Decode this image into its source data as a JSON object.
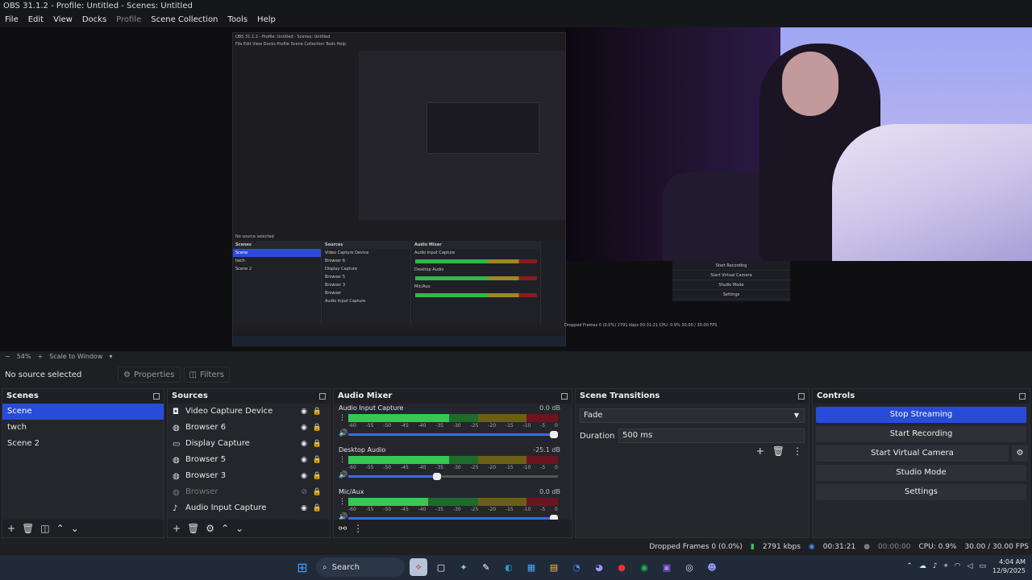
{
  "window": {
    "title": "OBS 31.1.2 - Profile: Untitled - Scenes: Untitled"
  },
  "menu": [
    "File",
    "Edit",
    "View",
    "Docks",
    "Profile",
    "Scene Collection",
    "Tools",
    "Help"
  ],
  "nested_preview": {
    "title": "OBS 31.1.2 - Profile: Untitled - Scenes: Untitled",
    "menu": "File  Edit  View  Docks  Profile  Scene Collection  Tools  Help",
    "source_label": "No source selected",
    "scenes": [
      "Scene",
      "twch",
      "Scene 2"
    ],
    "sources": [
      "Video Capture Device",
      "Browser 6",
      "Display Capture",
      "Browser 5",
      "Browser 3",
      "Browser",
      "Audio Input Capture"
    ],
    "mixer_channels": [
      "Audio Input Capture",
      "Desktop Audio",
      "Mic/Aux"
    ],
    "controls": [
      "Start Recording",
      "Start Virtual Camera",
      "Studio Mode",
      "Settings"
    ],
    "status": "Dropped Frames 0 (0.0%)  2791 kbps  00:31:21  CPU: 0.9%  30.00 / 30.00 FPS"
  },
  "zoom": {
    "level": "54%",
    "mode": "Scale to Window"
  },
  "source_bar": {
    "none": "No source selected",
    "properties": "Properties",
    "filters": "Filters"
  },
  "scenes": {
    "title": "Scenes",
    "items": [
      {
        "label": "Scene",
        "selected": true
      },
      {
        "label": "twch",
        "selected": false
      },
      {
        "label": "Scene 2",
        "selected": false
      }
    ]
  },
  "sources": {
    "title": "Sources",
    "items": [
      {
        "label": "Video Capture Device",
        "icon": "camera-icon",
        "visible": true
      },
      {
        "label": "Browser 6",
        "icon": "globe-icon",
        "visible": true
      },
      {
        "label": "Display Capture",
        "icon": "monitor-icon",
        "visible": true
      },
      {
        "label": "Browser 5",
        "icon": "globe-icon",
        "visible": true
      },
      {
        "label": "Browser 3",
        "icon": "globe-icon",
        "visible": true
      },
      {
        "label": "Browser",
        "icon": "globe-icon",
        "visible": false
      },
      {
        "label": "Audio Input Capture",
        "icon": "mic-icon",
        "visible": true
      }
    ]
  },
  "mixer": {
    "title": "Audio Mixer",
    "ticks": [
      "-60",
      "-55",
      "-50",
      "-45",
      "-40",
      "-35",
      "-30",
      "-25",
      "-20",
      "-15",
      "-10",
      "-5",
      "0"
    ],
    "channels": [
      {
        "name": "Audio Input Capture",
        "db": "0.0 dB",
        "level": 0.48,
        "volume": 1.0
      },
      {
        "name": "Desktop Audio",
        "db": "-25.1 dB",
        "level": 0.48,
        "volume": 0.42
      },
      {
        "name": "Mic/Aux",
        "db": "0.0 dB",
        "level": 0.38,
        "volume": 1.0
      }
    ]
  },
  "transitions": {
    "title": "Scene Transitions",
    "selected": "Fade",
    "duration_label": "Duration",
    "duration_value": "500 ms"
  },
  "controls": {
    "title": "Controls",
    "stop_streaming": "Stop Streaming",
    "start_recording": "Start Recording",
    "start_virtual_camera": "Start Virtual Camera",
    "studio_mode": "Studio Mode",
    "settings": "Settings"
  },
  "status": {
    "dropped_frames": "Dropped Frames 0 (0.0%)",
    "bitrate": "2791 kbps",
    "stream_time": "00:31:21",
    "rec_time": "00:00:00",
    "cpu": "CPU: 0.9%",
    "fps": "30.00 / 30.00 FPS"
  },
  "taskbar": {
    "search": "Search",
    "time": "4:04 AM",
    "date": "12/9/2025"
  },
  "colors": {
    "accent": "#284cd9",
    "meter_green": "#35c954",
    "meter_yellow": "#9a8a22",
    "meter_red": "#8a1a22"
  }
}
